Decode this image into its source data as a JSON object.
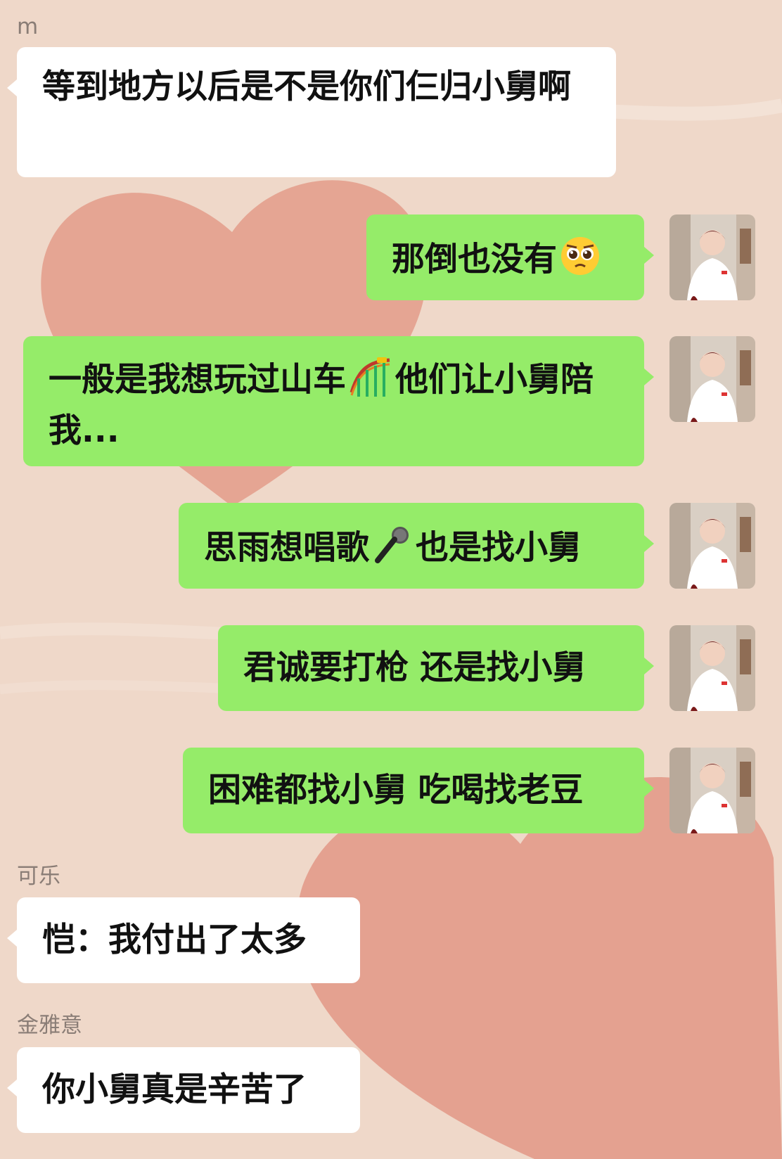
{
  "theme": {
    "background": "#efd8c9",
    "heart_color": "#e29886",
    "incoming_bubble": "#ffffff",
    "outgoing_bubble": "#95ec69",
    "sender_name_color": "#8a7d76"
  },
  "messages": [
    {
      "direction": "incoming",
      "sender": "m",
      "text": "等到地方以后是不是你们仨归小舅啊"
    },
    {
      "direction": "outgoing",
      "text": "那倒也没有",
      "emoji": "pleading-face-icon"
    },
    {
      "direction": "outgoing",
      "text_before": "一般是我想玩过山车",
      "emoji": "roller-coaster-icon",
      "text_after": "他们让小舅陪我..."
    },
    {
      "direction": "outgoing",
      "text_before": "思雨想唱歌",
      "emoji": "microphone-icon",
      "text_after": "也是找小舅"
    },
    {
      "direction": "outgoing",
      "text": "君诚要打枪 还是找小舅"
    },
    {
      "direction": "outgoing",
      "text": "困难都找小舅 吃喝找老豆"
    },
    {
      "direction": "incoming",
      "sender": "可乐",
      "text": "恺：我付出了太多"
    },
    {
      "direction": "incoming",
      "sender": "金雅意",
      "text": "你小舅真是辛苦了"
    }
  ]
}
